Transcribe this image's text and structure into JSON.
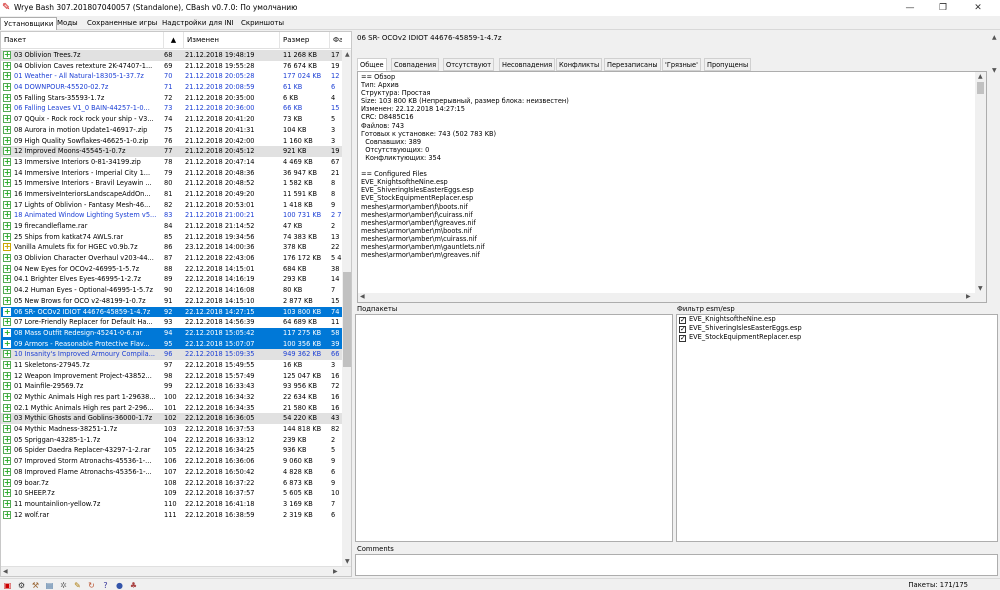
{
  "window": {
    "title": "Wrye Bash 307.201807040057 (Standalone), CBash v0.7.0: По умолчанию",
    "min": "—",
    "max": "❐",
    "close": "✕"
  },
  "tabs": [
    "Установщики",
    "Моды",
    "Сохраненные игры",
    "Надстройки для INI",
    "Скриншоты"
  ],
  "list": {
    "columns": {
      "package": "Пакет",
      "sort_arrow": "▲",
      "changed": "Изменен",
      "size": "Размер",
      "flags": "Фа"
    },
    "rows": [
      {
        "check": "+",
        "name": "03 Oblivion Trees.7z",
        "num": "68",
        "date": "21.12.2018 19:48:19",
        "size": "11 268 KB",
        "flag": "17",
        "style": "gray"
      },
      {
        "check": "+",
        "name": "04 Oblivion Caves retexture 2K-47407-1...",
        "num": "69",
        "date": "21.12.2018 19:55:28",
        "size": "76 674 KB",
        "flag": "19",
        "style": ""
      },
      {
        "check": "+",
        "name": "01 Weather - All Natural-18305-1-37.7z",
        "num": "70",
        "date": "21.12.2018 20:05:28",
        "size": "177 024 KB",
        "flag": "12",
        "style": "blue"
      },
      {
        "check": "+",
        "name": "04 DOWNPOUR-45520-02.7z",
        "num": "71",
        "date": "21.12.2018 20:08:59",
        "size": "61 KB",
        "flag": "6",
        "style": "blue"
      },
      {
        "check": "+",
        "name": "05 Falling Stars-35593-1.7z",
        "num": "72",
        "date": "21.12.2018 20:35:00",
        "size": "6 KB",
        "flag": "4",
        "style": ""
      },
      {
        "check": "+",
        "name": "06 Falling Leaves V1_0 BAIN-44257-1-0...",
        "num": "73",
        "date": "21.12.2018 20:36:00",
        "size": "66 KB",
        "flag": "15",
        "style": "blue"
      },
      {
        "check": "+",
        "name": "07 QQuix - Rock rock rock your ship - V3...",
        "num": "74",
        "date": "21.12.2018 20:41:20",
        "size": "73 KB",
        "flag": "5",
        "style": ""
      },
      {
        "check": "+",
        "name": "08 Aurora in motion Update1-46917-.zip",
        "num": "75",
        "date": "21.12.2018 20:41:31",
        "size": "104 KB",
        "flag": "3",
        "style": ""
      },
      {
        "check": "+",
        "name": "09 High Quality Sowflakes-46625-1-0.zip",
        "num": "76",
        "date": "21.12.2018 20:42:00",
        "size": "1 160 KB",
        "flag": "3",
        "style": ""
      },
      {
        "check": "+",
        "name": "12 Improved Moons-45545-1-0.7z",
        "num": "77",
        "date": "21.12.2018 20:45:12",
        "size": "921 KB",
        "flag": "19",
        "style": "gray"
      },
      {
        "check": "+",
        "name": "13 Immersive Interiors 0-81-34199.zip",
        "num": "78",
        "date": "21.12.2018 20:47:14",
        "size": "4 469 KB",
        "flag": "67",
        "style": ""
      },
      {
        "check": "+",
        "name": "14 Immersive Interiors - Imperial City 1...",
        "num": "79",
        "date": "21.12.2018 20:48:36",
        "size": "36 947 KB",
        "flag": "21",
        "style": ""
      },
      {
        "check": "+",
        "name": "15 Immersive Interiors - Bravil Leyawin ...",
        "num": "80",
        "date": "21.12.2018 20:48:52",
        "size": "1 582 KB",
        "flag": "8",
        "style": ""
      },
      {
        "check": "+",
        "name": "16 ImmersiveInteriorsLandscapeAddOn...",
        "num": "81",
        "date": "21.12.2018 20:49:20",
        "size": "11 591 KB",
        "flag": "8",
        "style": ""
      },
      {
        "check": "+",
        "name": "17 Lights of Oblivion - Fantasy Mesh-46...",
        "num": "82",
        "date": "21.12.2018 20:53:01",
        "size": "1 418 KB",
        "flag": "9",
        "style": ""
      },
      {
        "check": "+",
        "name": "18 Animated Window Lighting System v5...",
        "num": "83",
        "date": "21.12.2018 21:00:21",
        "size": "100 731 KB",
        "flag": "2 7",
        "style": "blue"
      },
      {
        "check": "+",
        "name": "19 firecandleflame.rar",
        "num": "84",
        "date": "21.12.2018 21:14:52",
        "size": "47 KB",
        "flag": "2",
        "style": ""
      },
      {
        "check": "+",
        "name": "25 Ships from katkat74 AWLS.rar",
        "num": "85",
        "date": "21.12.2018 19:34:56",
        "size": "74 383 KB",
        "flag": "13",
        "style": ""
      },
      {
        "check": "y",
        "name": "Vanilla Amulets fix for HGEC v0.9b.7z",
        "num": "86",
        "date": "23.12.2018 14:00:36",
        "size": "378 KB",
        "flag": "22",
        "style": ""
      },
      {
        "check": "+",
        "name": "03 Oblivion Character Overhaul v203-44...",
        "num": "87",
        "date": "21.12.2018 22:43:06",
        "size": "176 172 KB",
        "flag": "5 4",
        "style": ""
      },
      {
        "check": "+",
        "name": "04 New Eyes for OCOv2-46995-1-5.7z",
        "num": "88",
        "date": "22.12.2018 14:15:01",
        "size": "684 KB",
        "flag": "38",
        "style": ""
      },
      {
        "check": "+",
        "name": "04.1 Brighter Elves Eyes-46995-1-2.7z",
        "num": "89",
        "date": "22.12.2018 14:16:19",
        "size": "293 KB",
        "flag": "14",
        "style": ""
      },
      {
        "check": "+",
        "name": "04.2 Human Eyes - Optional-46995-1-5.7z",
        "num": "90",
        "date": "22.12.2018 14:16:08",
        "size": "80 KB",
        "flag": "7",
        "style": ""
      },
      {
        "check": "+",
        "name": "05 New Brows for OCO v2-48199-1-0.7z",
        "num": "91",
        "date": "22.12.2018 14:15:10",
        "size": "2 877 KB",
        "flag": "15",
        "style": ""
      },
      {
        "check": "+",
        "name": "06 SR- OCOv2 IDIOT 44676-45859-1-4.7z",
        "num": "92",
        "date": "22.12.2018 14:27:15",
        "size": "103 800 KB",
        "flag": "74",
        "style": "sel"
      },
      {
        "check": "+",
        "name": "07 Lore-Friendly Replacer for Default Ha...",
        "num": "93",
        "date": "22.12.2018 14:56:39",
        "size": "64 689 KB",
        "flag": "11",
        "style": ""
      },
      {
        "check": "+",
        "name": "08 Mass Outfit Redesign-45241-0-6.rar",
        "num": "94",
        "date": "22.12.2018 15:05:42",
        "size": "117 275 KB",
        "flag": "58",
        "style": "sel"
      },
      {
        "check": "+",
        "name": "09 Armors - Reasonable Protective Flav...",
        "num": "95",
        "date": "22.12.2018 15:07:07",
        "size": "100 356 KB",
        "flag": "39",
        "style": "sel"
      },
      {
        "check": "+",
        "name": "10 Insanity's Improved Armoury Compila...",
        "num": "96",
        "date": "22.12.2018 15:09:35",
        "size": "949 362 KB",
        "flag": "66",
        "style": "gray blue"
      },
      {
        "check": "+",
        "name": "11 Skeletons-27945.7z",
        "num": "97",
        "date": "22.12.2018 15:49:55",
        "size": "16 KB",
        "flag": "3",
        "style": ""
      },
      {
        "check": "+",
        "name": "12 Weapon Improvement Project-43852...",
        "num": "98",
        "date": "22.12.2018 15:57:49",
        "size": "125 047 KB",
        "flag": "16",
        "style": ""
      },
      {
        "check": "+",
        "name": "01 Mainfile-29569.7z",
        "num": "99",
        "date": "22.12.2018 16:33:43",
        "size": "93 956 KB",
        "flag": "72",
        "style": ""
      },
      {
        "check": "+",
        "name": "02 Mythic Animals High res part 1-29638...",
        "num": "100",
        "date": "22.12.2018 16:34:32",
        "size": "22 634 KB",
        "flag": "16",
        "style": ""
      },
      {
        "check": "+",
        "name": "02.1 Mythic Animals High res part 2-296...",
        "num": "101",
        "date": "22.12.2018 16:34:35",
        "size": "21 580 KB",
        "flag": "16",
        "style": ""
      },
      {
        "check": "+",
        "name": "03 Mythic Ghosts and Goblins-36000-1.7z",
        "num": "102",
        "date": "22.12.2018 16:36:05",
        "size": "54 220 KB",
        "flag": "43",
        "style": "gray"
      },
      {
        "check": "+",
        "name": "04 Mythic Madness-38251-1.7z",
        "num": "103",
        "date": "22.12.2018 16:37:53",
        "size": "144 818 KB",
        "flag": "82",
        "style": ""
      },
      {
        "check": "+",
        "name": "05 Spriggan-43285-1-1.7z",
        "num": "104",
        "date": "22.12.2018 16:33:12",
        "size": "239 KB",
        "flag": "2",
        "style": ""
      },
      {
        "check": "+",
        "name": "06 Spider Daedra Replacer-43297-1-2.rar",
        "num": "105",
        "date": "22.12.2018 16:34:25",
        "size": "936 KB",
        "flag": "5",
        "style": ""
      },
      {
        "check": "+",
        "name": "07 Improved Storm Atronachs-45536-1-...",
        "num": "106",
        "date": "22.12.2018 16:36:06",
        "size": "9 060 KB",
        "flag": "9",
        "style": ""
      },
      {
        "check": "+",
        "name": "08 Improved Flame Atronachs-45356-1-...",
        "num": "107",
        "date": "22.12.2018 16:50:42",
        "size": "4 828 KB",
        "flag": "6",
        "style": ""
      },
      {
        "check": "+",
        "name": "09 boar.7z",
        "num": "108",
        "date": "22.12.2018 16:37:22",
        "size": "6 873 KB",
        "flag": "9",
        "style": ""
      },
      {
        "check": "+",
        "name": "10 SHEEP.7z",
        "num": "109",
        "date": "22.12.2018 16:37:57",
        "size": "5 605 KB",
        "flag": "10",
        "style": ""
      },
      {
        "check": "+",
        "name": "11 mountainlion-yellow.7z",
        "num": "110",
        "date": "22.12.2018 16:41:18",
        "size": "3 169 KB",
        "flag": "7",
        "style": ""
      },
      {
        "check": "+",
        "name": "12 wolf.rar",
        "num": "111",
        "date": "22.12.2018 16:38:59",
        "size": "2 319 KB",
        "flag": "6",
        "style": ""
      }
    ]
  },
  "details": {
    "package_name": "06 SR- OCOv2 IDIOT 44676-45859-1-4.7z",
    "tabs": [
      "Общее",
      "Совпадения",
      "Отсутствуют",
      "Несовпадения",
      "Конфликты",
      "Перезаписаны",
      "'Грязные'",
      "Пропущены"
    ],
    "info_text": "== Обзор\nТип: Архив\nСтруктура: Простая\nSize: 103 800 KB (Непрерывный, размер блока: неизвестен)\nИзменен: 22.12.2018 14:27:15\nCRC: D8485C16\nФайлов: 743\nГотовых к установке: 743 (502 783 KB)\n  Совпавших: 389\n  Отсутствующих: 0\n  Конфликтующих: 354\n\n== Configured Files\nEVE_KnightsoftheNine.esp\nEVE_ShiveringIslesEasterEggs.esp\nEVE_StockEquipmentReplacer.esp\nmeshes\\armor\\amber\\f\\boots.nif\nmeshes\\armor\\amber\\f\\cuirass.nif\nmeshes\\armor\\amber\\f\\greaves.nif\nmeshes\\armor\\amber\\m\\boots.nif\nmeshes\\armor\\amber\\m\\cuirass.nif\nmeshes\\armor\\amber\\m\\gauntlets.nif\nmeshes\\armor\\amber\\m\\greaves.nif",
    "subpackages_label": "Подпакеты",
    "esm_filter_label": "Фильтр esm/esp",
    "esm_items": [
      "EVE_KnightsoftheNine.esp",
      "EVE_ShiveringIslesEasterEggs.esp",
      "EVE_StockEquipmentReplacer.esp"
    ],
    "comments_label": "Comments"
  },
  "status": {
    "packages": "Пакеты: 171/175"
  },
  "colors": {
    "selection": "#0078d7",
    "blue_text": "#1c3fd4",
    "gray_row": "#e1e1e1"
  }
}
